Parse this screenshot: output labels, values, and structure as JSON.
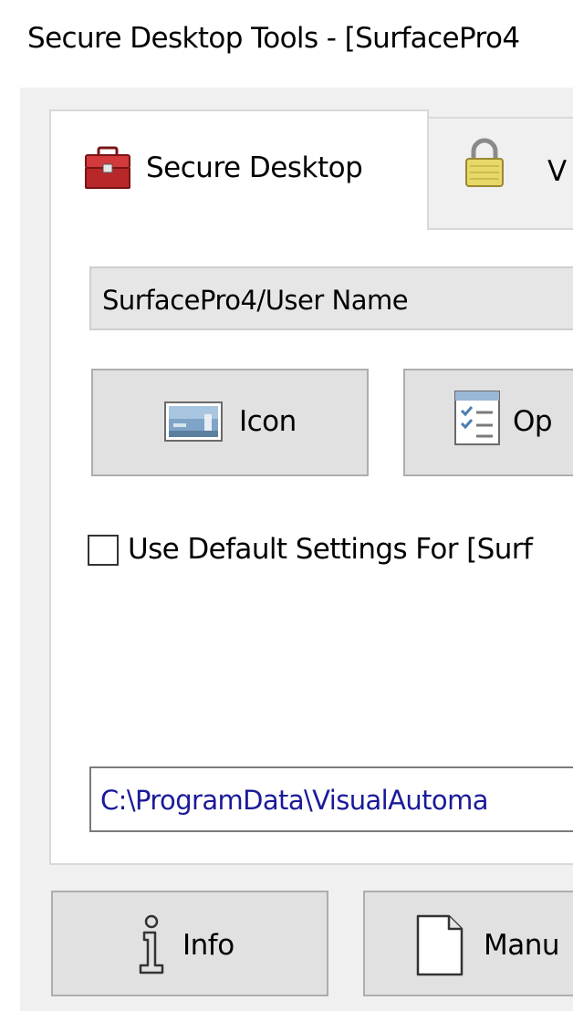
{
  "window": {
    "title": "Secure Desktop Tools - [SurfacePro4"
  },
  "tabs": [
    {
      "label": "Secure Desktop",
      "icon": "toolbox-icon",
      "active": true
    },
    {
      "label": "V",
      "icon": "padlock-icon",
      "active": false
    }
  ],
  "user_select": {
    "value": "SurfacePro4/User Name"
  },
  "buttons": {
    "icon_label": "Icon",
    "options_label": "Op",
    "info_label": "Info",
    "manual_label": "Manu"
  },
  "default_settings": {
    "label": "Use Default Settings For [Surf",
    "checked": false
  },
  "path_field": {
    "value": "C:\\ProgramData\\VisualAutoma"
  },
  "colors": {
    "path_text": "#1a1a9a",
    "toolbox_red": "#c0282b",
    "padlock_yellow": "#e8d86a"
  }
}
